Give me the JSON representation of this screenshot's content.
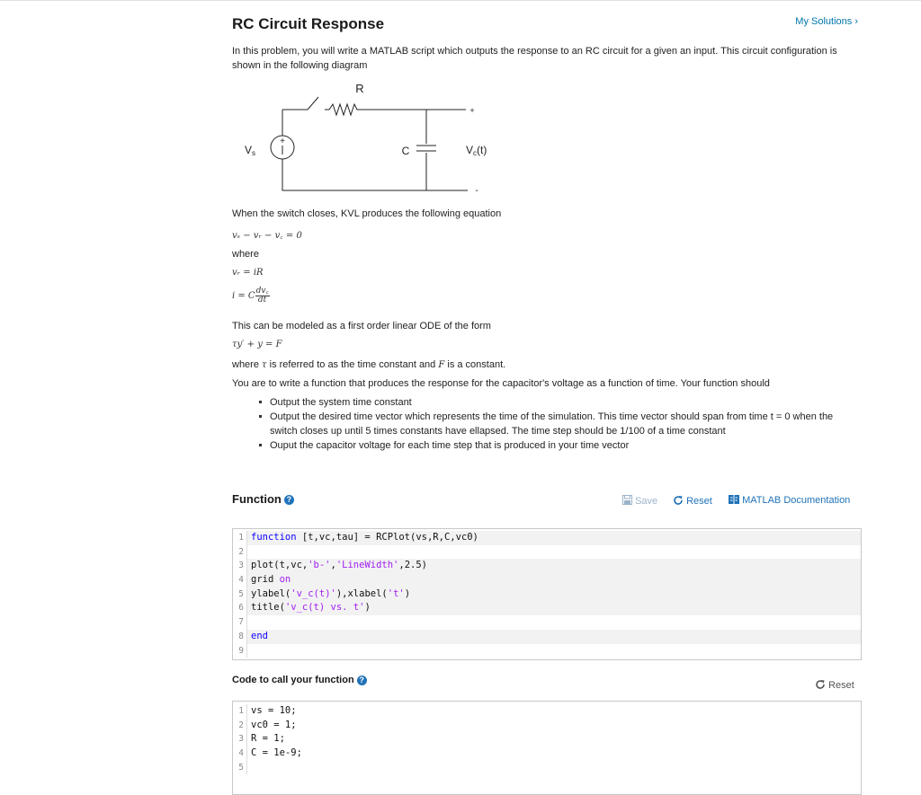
{
  "header": {
    "title": "RC Circuit Response",
    "my_solutions": "My Solutions ›"
  },
  "intro": "In this problem, you will write a MATLAB script which outputs the response to an RC circuit for a given an input. This circuit configuration is shown in the following diagram",
  "diagram": {
    "r_label": "R",
    "c_label": "C",
    "vs_label": "V",
    "vs_sub": "s",
    "vc_label": "V",
    "vc_sub": "c",
    "vc_t": "(t)",
    "plus": "+",
    "minus": "-",
    "source_plus": "+"
  },
  "text": {
    "switch_closes": "When the switch closes, KVL produces the following equation",
    "eq1": "vₛ − vᵣ − v꜀ = 0",
    "where": "where",
    "eq2": "vᵣ = iR",
    "eq3_left": "i = C",
    "eq3_num": "dv꜀",
    "eq3_den": "dt",
    "modeled": "This can be modeled as a first order linear ODE of the form",
    "eq4": "τy′ + y = F",
    "where2_a": "where",
    "where2_tau": "τ",
    "where2_b": "is referred to as the time constant and",
    "where2_F": "F",
    "where2_c": "is a constant.",
    "task": "You are to write a function that produces the response for the capacitor's voltage as a function of time. Your function should"
  },
  "bullets": [
    "Output the system time constant",
    "Output the desired time vector which represents the time of the simulation. This time vector should span from time t = 0 when the switch closes up until 5 times constants have ellapsed. The time step should be 1/100 of a time constant",
    "Ouput the capacitor voltage for each time step that is produced in your time vector"
  ],
  "function_section": {
    "title": "Function",
    "save": "Save",
    "reset": "Reset",
    "docs": "MATLAB Documentation",
    "lines": [
      {
        "n": "1",
        "text": "function [t,vc,tau] = RCPlot(vs,R,C,vc0)"
      },
      {
        "n": "2",
        "text": ""
      },
      {
        "n": "3",
        "text": "plot(t,vc,'b-','LineWidth',2.5)"
      },
      {
        "n": "4",
        "text": "grid on"
      },
      {
        "n": "5",
        "text": "ylabel('v_c(t)'),xlabel('t')"
      },
      {
        "n": "6",
        "text": "title('v_c(t) vs. t')"
      },
      {
        "n": "7",
        "text": ""
      },
      {
        "n": "8",
        "text": "end"
      },
      {
        "n": "9",
        "text": ""
      }
    ]
  },
  "call_section": {
    "title": "Code to call your function",
    "reset": "Reset",
    "lines": [
      {
        "n": "1",
        "text": "vs = 10;"
      },
      {
        "n": "2",
        "text": "vc0 = 1;"
      },
      {
        "n": "3",
        "text": "R = 1;"
      },
      {
        "n": "4",
        "text": "C = 1e-9;"
      },
      {
        "n": "5",
        "text": ""
      }
    ]
  },
  "colors": {
    "link": "#0076a8",
    "help": "#1f72b8",
    "keyword": "#0e00ff",
    "string": "#a020f0"
  }
}
